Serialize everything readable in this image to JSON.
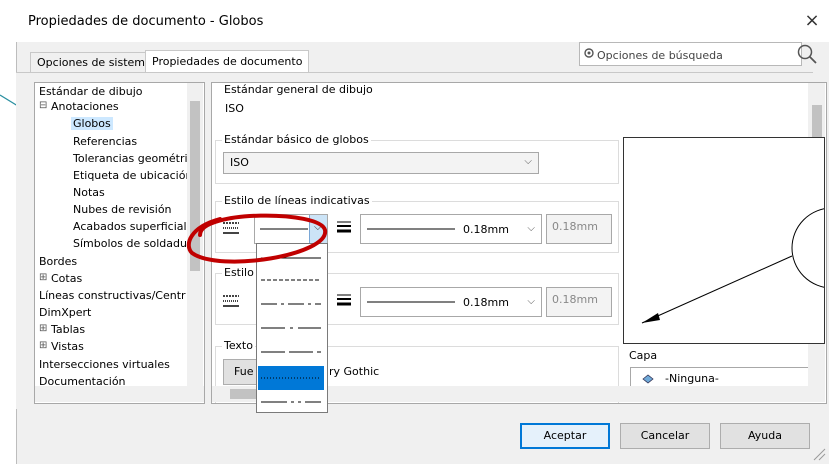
{
  "window": {
    "title": "Propiedades de documento - Globos",
    "close_label": "×"
  },
  "tabs": [
    {
      "label": "Opciones de sistema"
    },
    {
      "label": "Propiedades de documento"
    }
  ],
  "search": {
    "placeholder": "Opciones de búsqueda"
  },
  "tree": {
    "items": [
      {
        "label": "Estándar de dibujo"
      },
      {
        "label": "Anotaciones"
      },
      {
        "label": "Globos"
      },
      {
        "label": "Referencias"
      },
      {
        "label": "Tolerancias geométrica"
      },
      {
        "label": "Etiqueta de ubicación"
      },
      {
        "label": "Notas"
      },
      {
        "label": "Nubes de revisión"
      },
      {
        "label": "Acabados superficiales"
      },
      {
        "label": "Símbolos de soldadur"
      },
      {
        "label": "Bordes"
      },
      {
        "label": "Cotas"
      },
      {
        "label": "Líneas constructivas/Centr"
      },
      {
        "label": "DimXpert"
      },
      {
        "label": "Tablas"
      },
      {
        "label": "Vistas"
      },
      {
        "label": "Intersecciones virtuales"
      },
      {
        "label": "Documentación"
      }
    ]
  },
  "content": {
    "general_standard": {
      "label": "Estándar general de dibujo",
      "value": "ISO"
    },
    "base_standard": {
      "label": "Estándar básico de globos",
      "value": "ISO"
    },
    "leader_style": {
      "label": "Estilo de líneas indicativas",
      "thickness": "0.18mm",
      "custom_thickness": "0.18mm"
    },
    "frame_style": {
      "label": "Estilo",
      "thickness": "0.18mm",
      "custom_thickness": "0.18mm"
    },
    "text": {
      "label": "Texto",
      "font_button": "Fue",
      "font_name": "ry Gothic"
    },
    "layer": {
      "label": "Capa",
      "value": "-Ninguna-"
    }
  },
  "line_style_options": {
    "selected_index": 5,
    "count": 7
  },
  "buttons": {
    "ok": "Aceptar",
    "cancel": "Cancelar",
    "help": "Ayuda"
  },
  "colors": {
    "accent": "#0078d7",
    "annotation": "#c00000",
    "callout_line": "#2a8fa0"
  }
}
